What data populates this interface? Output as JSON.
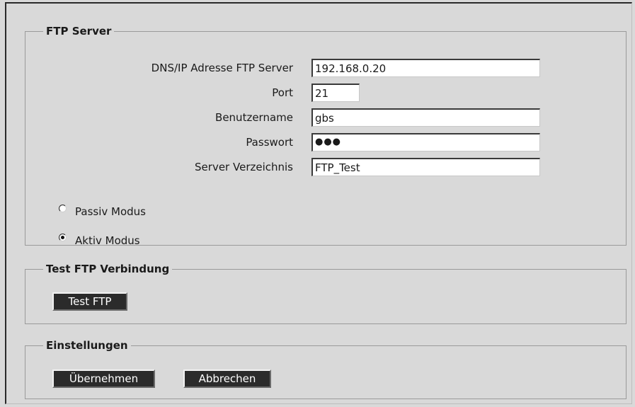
{
  "ftp_server": {
    "legend": "FTP Server",
    "dns_label": "DNS/IP Adresse FTP Server",
    "dns_value": "192.168.0.20",
    "port_label": "Port",
    "port_value": "21",
    "user_label": "Benutzername",
    "user_value": "gbs",
    "password_label": "Passwort",
    "password_value": "●●●",
    "dir_label": "Server Verzeichnis",
    "dir_value": "FTP_Test",
    "mode_options": [
      {
        "label": "Passiv Modus",
        "checked": false
      },
      {
        "label": "Aktiv Modus",
        "checked": true
      }
    ]
  },
  "test_connection": {
    "legend": "Test FTP Verbindung",
    "test_button": "Test FTP"
  },
  "settings": {
    "legend": "Einstellungen",
    "apply_button": "Übernehmen",
    "cancel_button": "Abbrechen"
  }
}
